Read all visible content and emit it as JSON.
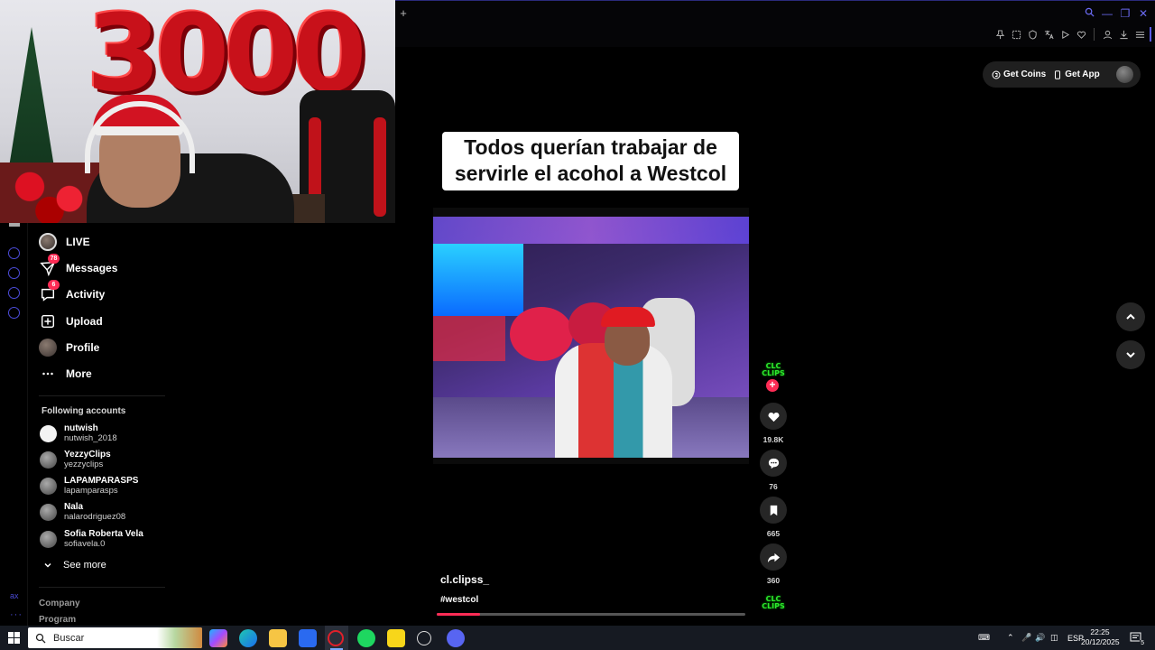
{
  "webcam": {
    "balloons_text": "3000"
  },
  "sidebar": {
    "nav": [
      {
        "label": "LIVE",
        "icon": "live-avatar-icon"
      },
      {
        "label": "Messages",
        "icon": "paper-plane-icon",
        "badge": "78"
      },
      {
        "label": "Activity",
        "icon": "inbox-icon",
        "badge": "6"
      },
      {
        "label": "Upload",
        "icon": "plus-square-icon"
      },
      {
        "label": "Profile",
        "icon": "profile-avatar-icon"
      },
      {
        "label": "More",
        "icon": "ellipsis-icon"
      }
    ],
    "following_title": "Following accounts",
    "accounts": [
      {
        "name": "nutwish",
        "handle": "nutwish_2018"
      },
      {
        "name": "YezzyClips",
        "handle": "yezzyclips"
      },
      {
        "name": "LAPAMPARASPS",
        "handle": "lapamparasps"
      },
      {
        "name": "Nala",
        "handle": "nalarodriguez08"
      },
      {
        "name": "Sofia Roberta Vela",
        "handle": "sofiavela.0"
      }
    ],
    "see_more": "See more",
    "footer": [
      "Company",
      "Program"
    ]
  },
  "video": {
    "caption_line1": "Todos querían trabajar de",
    "caption_line2": "servirle el acohol a Westcol",
    "author": "cl.clipss_",
    "hashtag": "#westcol",
    "progress": 0.14
  },
  "actions": {
    "creator_logo_text": "CLC CLIPS",
    "likes": "19.8K",
    "comments": "76",
    "saves": "665",
    "shares": "360"
  },
  "header": {
    "get_coins": "Get Coins",
    "get_app": "Get App"
  },
  "taskbar": {
    "search_placeholder": "Buscar",
    "language": "ESP",
    "time": "22:25",
    "date": "20/12/2025",
    "notification_count": "5"
  },
  "colors": {
    "accent": "#fe2c55",
    "browser_accent": "#5b5bf0",
    "creator_logo": "#2ee82e"
  }
}
